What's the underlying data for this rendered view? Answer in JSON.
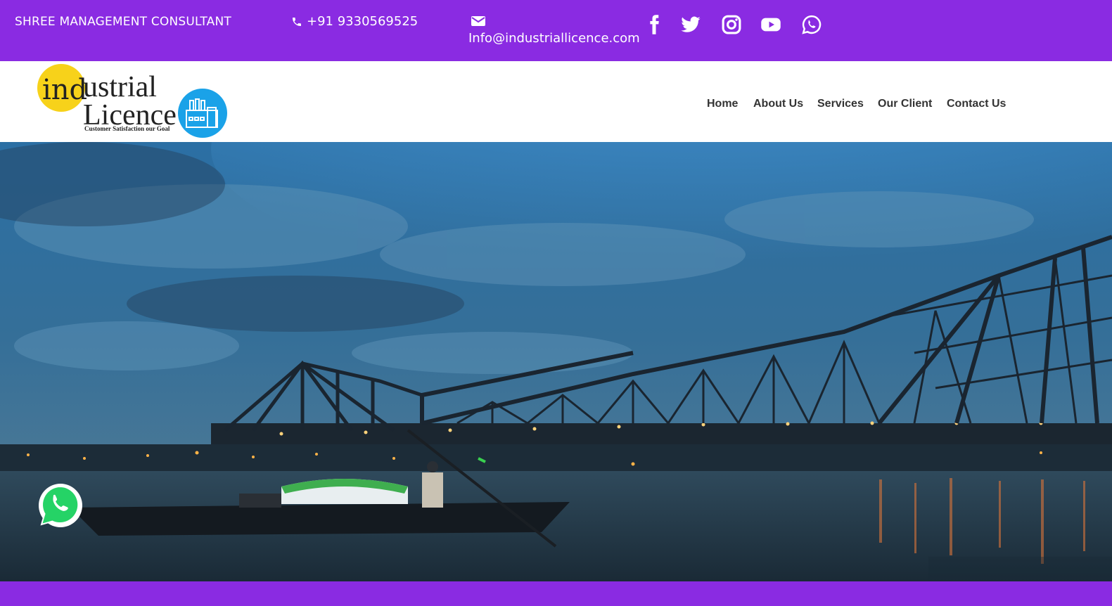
{
  "topbar": {
    "company": "SHREE MANAGEMENT CONSULTANT",
    "phone": "+91 9330569525",
    "email": "Info@industriallicence.com",
    "social_icons": [
      "facebook-icon",
      "twitter-icon",
      "instagram-icon",
      "youtube-icon",
      "whatsapp-icon"
    ],
    "color": "#8a2be2"
  },
  "logo": {
    "line1": "ustrial",
    "prefix": "ind",
    "line2": "Licence",
    "tagline": "Customer Satisfaction our Goal"
  },
  "nav": {
    "items": [
      "Home",
      "About Us",
      "Services",
      "Our Client",
      "Contact Us"
    ]
  },
  "hero": {
    "image": "evening photo of a steel cantilever bridge over a river with a wooden boat in the foreground"
  },
  "floating": {
    "icon": "whatsapp-icon"
  }
}
